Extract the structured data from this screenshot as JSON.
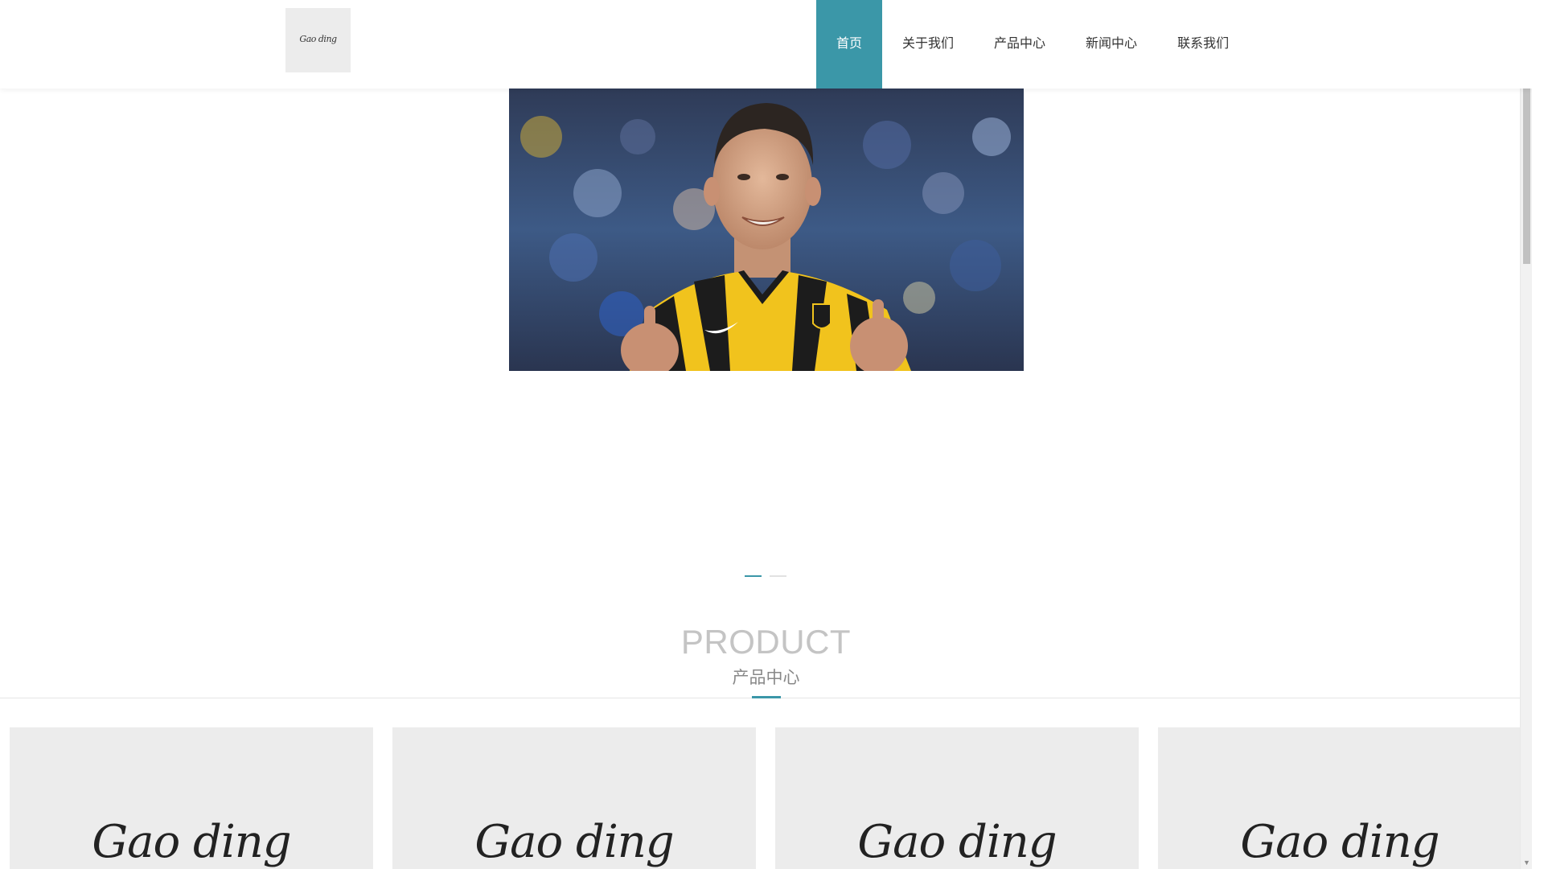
{
  "header": {
    "logo": {
      "script_text": "Gao ding"
    },
    "nav": [
      {
        "label": "首页",
        "active": true
      },
      {
        "label": "关于我们",
        "active": false
      },
      {
        "label": "产品中心",
        "active": false
      },
      {
        "label": "新闻中心",
        "active": false
      },
      {
        "label": "联系我们",
        "active": false
      }
    ]
  },
  "banner": {
    "slide_count": 2,
    "active_slide": 1
  },
  "section": {
    "title_en": "PRODUCT",
    "title_cn": "产品中心"
  },
  "products": [
    {
      "brand_text": "Gao ding"
    },
    {
      "brand_text": "Gao ding"
    },
    {
      "brand_text": "Gao ding"
    },
    {
      "brand_text": "Gao ding"
    }
  ],
  "colors": {
    "accent": "#3b97a8",
    "card_bg": "#ececec",
    "title_en": "#c4c4c4"
  }
}
